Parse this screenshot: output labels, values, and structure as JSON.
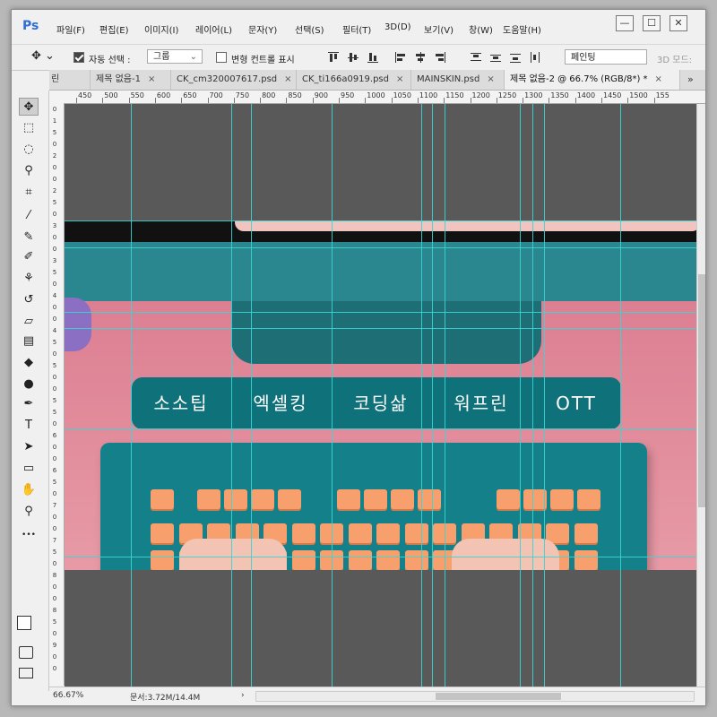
{
  "app": {
    "logo": "Ps"
  },
  "menu": [
    "파일(F)",
    "편집(E)",
    "이미지(I)",
    "레이어(L)",
    "문자(Y)",
    "선택(S)",
    "필터(T)",
    "3D(D)",
    "보기(V)",
    "창(W)",
    "도움말(H)"
  ],
  "window_controls": {
    "minimize": "—",
    "maximize": "☐",
    "close": "✕"
  },
  "options": {
    "auto_select_label": "자동 선택 :",
    "auto_select_value": "그룹",
    "transform_label": "변형 컨트롤 표시",
    "workspace_value": "페인팅",
    "mode_label": "3D 모드:"
  },
  "tabs": [
    {
      "label": "린"
    },
    {
      "label": "제목 없음-1"
    },
    {
      "label": "CK_cm320007617.psd"
    },
    {
      "label": "CK_ti166a0919.psd"
    },
    {
      "label": "MAINSKIN.psd"
    },
    {
      "label": "제목 없음-2 @ 66.7% (RGB/8*) *"
    }
  ],
  "tab_overflow": "»",
  "ruler_top": [
    "450",
    "500",
    "550",
    "600",
    "650",
    "700",
    "750",
    "800",
    "850",
    "900",
    "950",
    "1000",
    "1050",
    "1100",
    "1150",
    "1200",
    "1250",
    "1300",
    "1350",
    "1400",
    "1450",
    "1500",
    "155"
  ],
  "ruler_left": [
    "0",
    "1",
    "5",
    "0",
    "2",
    "0",
    "0",
    "2",
    "5",
    "0",
    "3",
    "0",
    "0",
    "3",
    "5",
    "0",
    "4",
    "0",
    "0",
    "4",
    "5",
    "0",
    "5",
    "0",
    "0",
    "5",
    "5",
    "0",
    "6",
    "0",
    "0",
    "6",
    "5",
    "0",
    "7",
    "0",
    "0",
    "7",
    "5",
    "0",
    "8",
    "0",
    "0",
    "8",
    "5",
    "0",
    "9",
    "0",
    "0"
  ],
  "tools": [
    {
      "name": "move-tool",
      "glyph": "✥"
    },
    {
      "name": "marquee-tool",
      "glyph": "⬚"
    },
    {
      "name": "lasso-tool",
      "glyph": "◌"
    },
    {
      "name": "magic-wand-tool",
      "glyph": "⚲"
    },
    {
      "name": "crop-tool",
      "glyph": "⌗"
    },
    {
      "name": "eyedropper-tool",
      "glyph": "⁄"
    },
    {
      "name": "healing-brush-tool",
      "glyph": "✎"
    },
    {
      "name": "brush-tool",
      "glyph": "✐"
    },
    {
      "name": "clone-stamp-tool",
      "glyph": "⚘"
    },
    {
      "name": "history-brush-tool",
      "glyph": "↺"
    },
    {
      "name": "eraser-tool",
      "glyph": "▱"
    },
    {
      "name": "gradient-tool",
      "glyph": "▤"
    },
    {
      "name": "blur-tool",
      "glyph": "◆"
    },
    {
      "name": "dodge-tool",
      "glyph": "●"
    },
    {
      "name": "pen-tool",
      "glyph": "✒"
    },
    {
      "name": "type-tool",
      "glyph": "T"
    },
    {
      "name": "path-selection-tool",
      "glyph": "➤"
    },
    {
      "name": "shape-tool",
      "glyph": "▭"
    },
    {
      "name": "hand-tool",
      "glyph": "✋"
    },
    {
      "name": "zoom-tool",
      "glyph": "⚲"
    },
    {
      "name": "more-tools",
      "glyph": "•••"
    }
  ],
  "canvas": {
    "menu_items": [
      "소소팁",
      "엑셀킹",
      "코딩삶",
      "워프린",
      "OTT"
    ]
  },
  "status": {
    "zoom": "66.67%",
    "doc_size": "문서:3.72M/14.4M"
  },
  "colors": {
    "teal": "#0f7179",
    "pink": "#e08a9a",
    "key": "#f7a06d",
    "guide": "#37d6d4"
  }
}
